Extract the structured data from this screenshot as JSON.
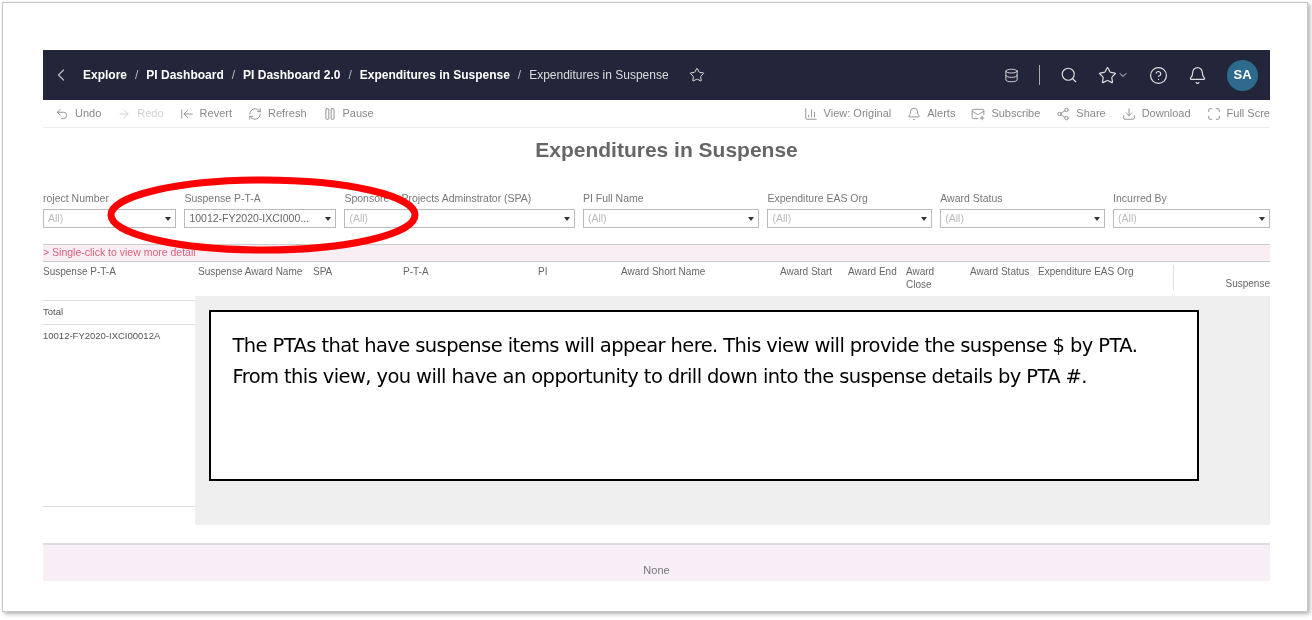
{
  "header": {
    "breadcrumbs": [
      {
        "label": "Explore",
        "current": false
      },
      {
        "label": "PI Dashboard",
        "current": false
      },
      {
        "label": "PI Dashboard 2.0",
        "current": false
      },
      {
        "label": "Expenditures in Suspense",
        "current": false
      },
      {
        "label": "Expenditures in Suspense",
        "current": true
      }
    ],
    "separator": "/",
    "avatar": "SA"
  },
  "toolbar": {
    "left": [
      {
        "kind": "undo",
        "label": "Undo",
        "disabled": false
      },
      {
        "kind": "redo",
        "label": "Redo",
        "disabled": true
      },
      {
        "kind": "revert",
        "label": "Revert",
        "disabled": false
      },
      {
        "kind": "refresh",
        "label": "Refresh",
        "disabled": false
      },
      {
        "kind": "pause",
        "label": "Pause",
        "disabled": false
      }
    ],
    "right": [
      {
        "kind": "view",
        "label": "View: Original",
        "disabled": false
      },
      {
        "kind": "alerts",
        "label": "Alerts",
        "disabled": false
      },
      {
        "kind": "subscribe",
        "label": "Subscribe",
        "disabled": false
      },
      {
        "kind": "share",
        "label": "Share",
        "disabled": false
      },
      {
        "kind": "download",
        "label": "Download",
        "disabled": false
      },
      {
        "kind": "fullscreen",
        "label": "Full Scre",
        "disabled": false
      }
    ]
  },
  "title": "Expenditures in Suspense",
  "filters": [
    {
      "label": "roject Number",
      "value": "All)",
      "chosen": false
    },
    {
      "label": "Suspense P-T-A",
      "value": "10012-FY2020-IXCI000...",
      "chosen": true
    },
    {
      "label": "Sponsore",
      "label_rest": "Projects Adminstrator (SPA)",
      "value": "(All)",
      "chosen": false
    },
    {
      "label": "PI Full Name",
      "value": "(All)",
      "chosen": false
    },
    {
      "label": "Expenditure EAS Org",
      "value": "(All)",
      "chosen": false
    },
    {
      "label": "Award Status",
      "value": "(All)",
      "chosen": false
    },
    {
      "label": "Incurred By",
      "value": "(All)",
      "chosen": false
    }
  ],
  "hint": "> Single-click  to view more detail",
  "table": {
    "columns": [
      "Suspense P-T-A",
      "Suspense Award Name",
      "SPA",
      "P-T-A",
      "PI",
      "Award Short Name",
      "Award Start",
      "Award End",
      "Award Close",
      "Award Status",
      "Expenditure EAS Org",
      "Suspense"
    ],
    "rows": [
      "Total",
      "10012-FY2020-IXCI00012A"
    ]
  },
  "callout": "The PTAs that have suspense items will appear here.  This view will provide the suspense $ by PTA. From this view, you will have an opportunity to drill down into the suspense details by PTA #.",
  "footer": "None"
}
